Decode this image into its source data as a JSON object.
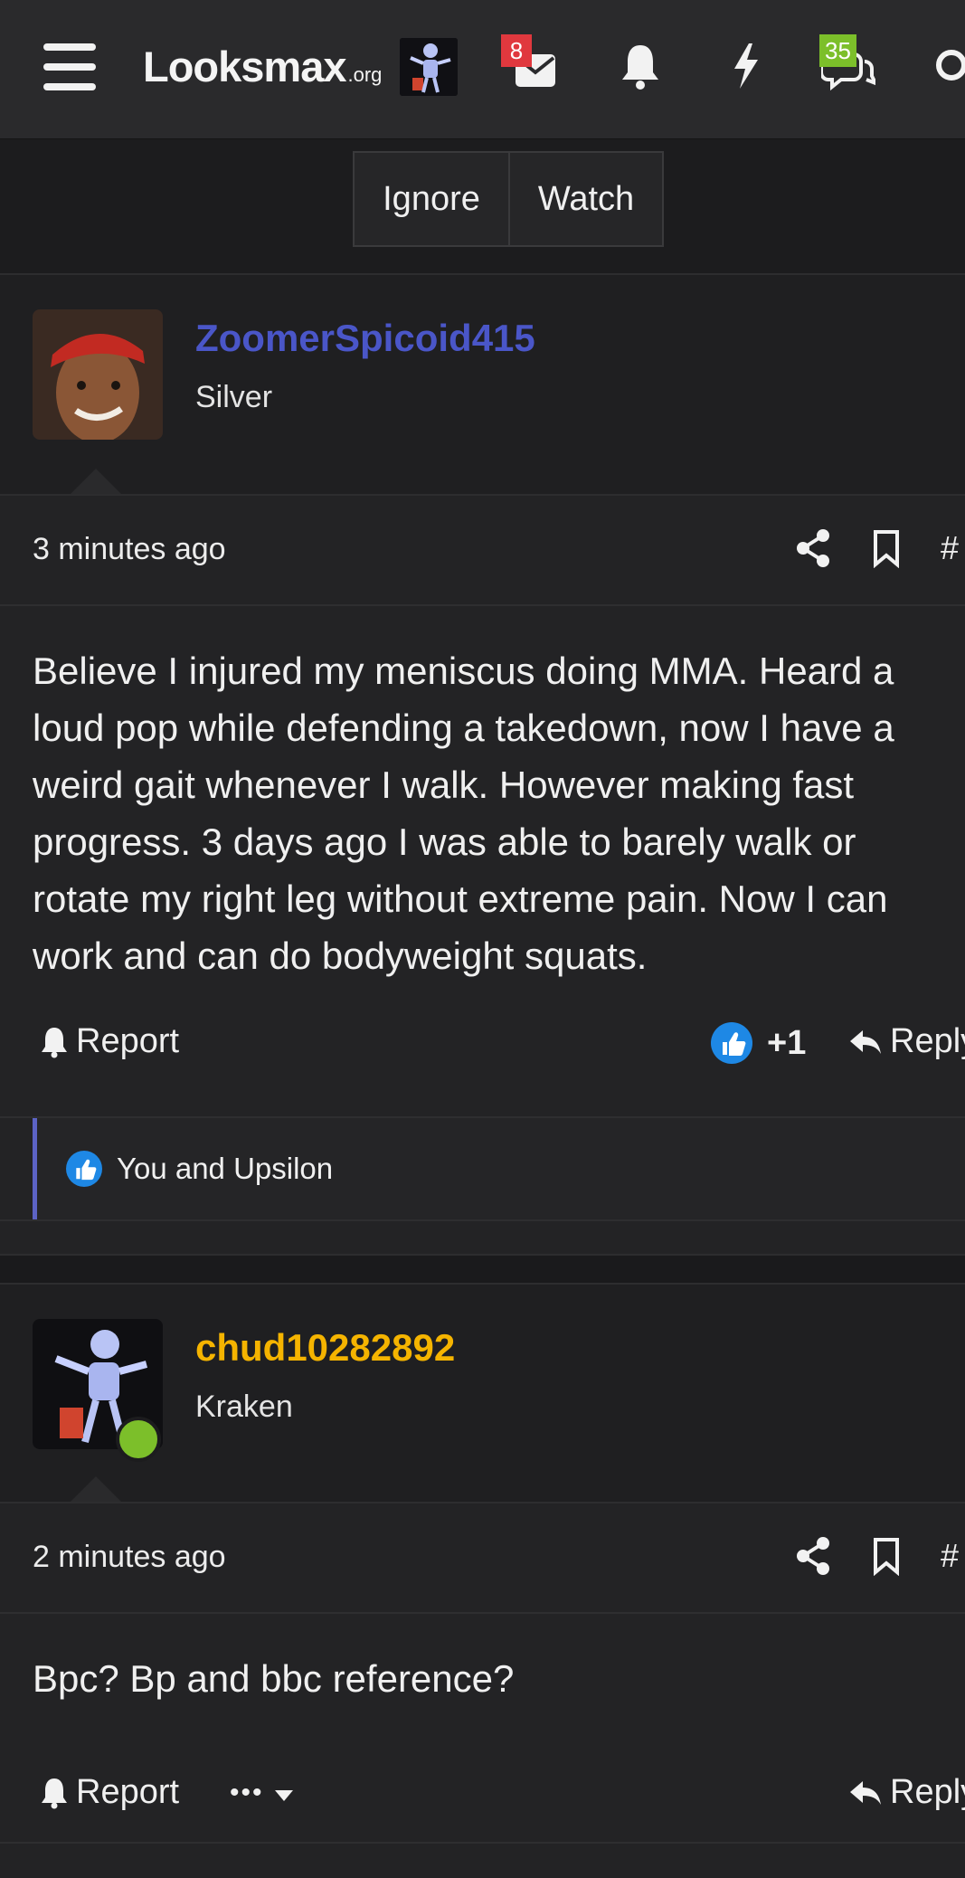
{
  "header": {
    "logo": "Looksmax",
    "logo_suffix": ".org",
    "messages_badge": "8",
    "conversations_badge": "35",
    "accent_badge_red": "#e0383e",
    "accent_badge_green": "#7cbf2a"
  },
  "thread_actions": {
    "ignore_label": "Ignore",
    "watch_label": "Watch"
  },
  "posts": [
    {
      "username": "ZoomerSpicoid415",
      "username_color": "#4a56c8",
      "user_title": "Silver",
      "timestamp": "3 minutes ago",
      "hash": "#",
      "body": "Believe I injured my meniscus doing MMA. Heard a\nloud pop while defending a takedown, now I have a\nweird gait whenever I walk. However making fast\nprogress. 3 days ago I was able to barely walk or\nrotate my right leg without extreme pain. Now I can\nwork and can do bodyweight squats.",
      "report_label": "Report",
      "like_count": "+1",
      "reply_label": "Reply",
      "likes_summary": "You and Upsilon"
    },
    {
      "username": "chud10282892",
      "username_color": "#f5b400",
      "user_title": "Kraken",
      "timestamp": "2 minutes ago",
      "hash": "#",
      "body": "Bpc? Bp and bbc reference?",
      "report_label": "Report",
      "more_label": "•••",
      "reply_label": "Reply"
    }
  ]
}
